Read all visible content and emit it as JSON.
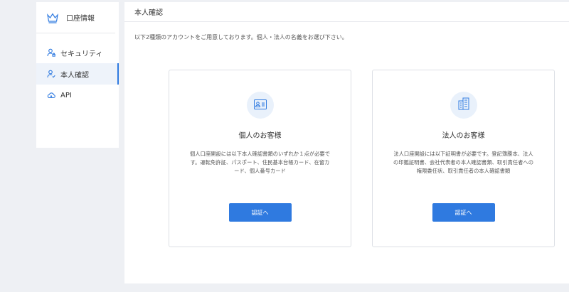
{
  "sidebar": {
    "header": {
      "title": "口座情報"
    },
    "items": [
      {
        "label": "セキュリティ",
        "icon": "user-lock-icon"
      },
      {
        "label": "本人確認",
        "icon": "user-check-icon",
        "active": true
      },
      {
        "label": "API",
        "icon": "cloud-icon"
      }
    ]
  },
  "main": {
    "title": "本人確認",
    "intro": "以下2種類のアカウントをご用意しております。個人・法人の名義をお選び下さい。",
    "cards": [
      {
        "icon": "id-card-icon",
        "title": "個人のお客様",
        "description": "個人口座開設には以下本人確認書類のいずれか１点が必要です。運転免許証、パスポート、住民基本台帳カード、在留カード、個人番号カード",
        "button": "認証へ"
      },
      {
        "icon": "building-icon",
        "title": "法人のお客様",
        "description": "法人口座開設には以下証明書が必要です。登記簿謄本、法人の印鑑証明書、会社代表者の本人確認書類、取引責任者への権限委任状、取引責任者の本人確認書類",
        "button": "認証へ"
      }
    ]
  },
  "colors": {
    "accent": "#2f7ae0",
    "icon_bg": "#e9f1fb"
  }
}
